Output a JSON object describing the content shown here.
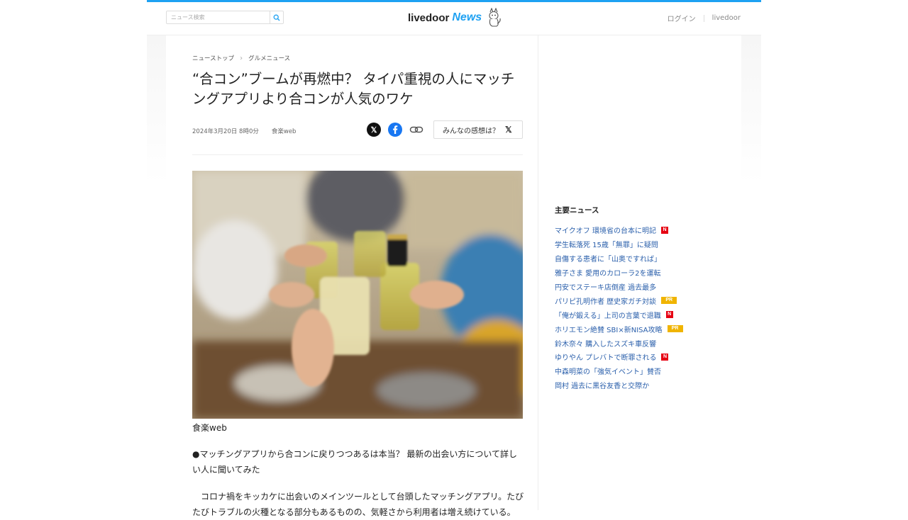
{
  "header": {
    "search_placeholder": "ニュース検索",
    "logo_text": "livedoor",
    "logo_news": "News",
    "login_label": "ログイン",
    "livedoor_label": "livedoor",
    "accent_color": "#1ea1f2"
  },
  "breadcrumb": {
    "items": [
      "ニューストップ",
      "グルメニュース"
    ]
  },
  "article": {
    "title": "“合コン”ブームが再燃中？ タイパ重視の人にマッチングアプリより合コンが人気のワケ",
    "date": "2024年3月20日 8時0分",
    "source": "食楽web",
    "reaction_label": "みんなの感想は？",
    "photo_caption": "食楽web",
    "lead": "●マッチングアプリから合コンに戻りつつあるは本当？ 最新の出会い方について詳しい人に聞いてみた",
    "body": "コロナ禍をキッカケに出会いのメインツールとして台頭したマッチングアプリ。たびたびトラブルの火種となる部分もあるものの、気軽さから利用者は増え続けている。"
  },
  "share": {
    "icons": [
      "x-icon",
      "facebook-icon",
      "link-icon"
    ]
  },
  "sidebar": {
    "title": "主要ニュース",
    "items": [
      {
        "label": "マイクオフ 環境省の台本に明記",
        "badge": "N"
      },
      {
        "label": "学生転落死 15歳「無罪」に疑問",
        "badge": ""
      },
      {
        "label": "自傷する患者に「山奥ですれば」",
        "badge": ""
      },
      {
        "label": "雅子さま 愛用のカローラ2を運転",
        "badge": ""
      },
      {
        "label": "円安でステーキ店倒産 過去最多",
        "badge": ""
      },
      {
        "label": "パリピ孔明作者 歴史家ガチ対談",
        "badge": "PR"
      },
      {
        "label": "「俺が鍛える」上司の言葉で退職",
        "badge": "N"
      },
      {
        "label": "ホリエモン絶賛 SBI×新NISA攻略",
        "badge": "PR"
      },
      {
        "label": "鈴木奈々 購入したスズキ車反響",
        "badge": ""
      },
      {
        "label": "ゆりやん プレバトで断罪される",
        "badge": "N"
      },
      {
        "label": "中森明菜の「強気イベント」賛否",
        "badge": ""
      },
      {
        "label": "岡村 過去に黒谷友香と交際か",
        "badge": ""
      }
    ]
  }
}
